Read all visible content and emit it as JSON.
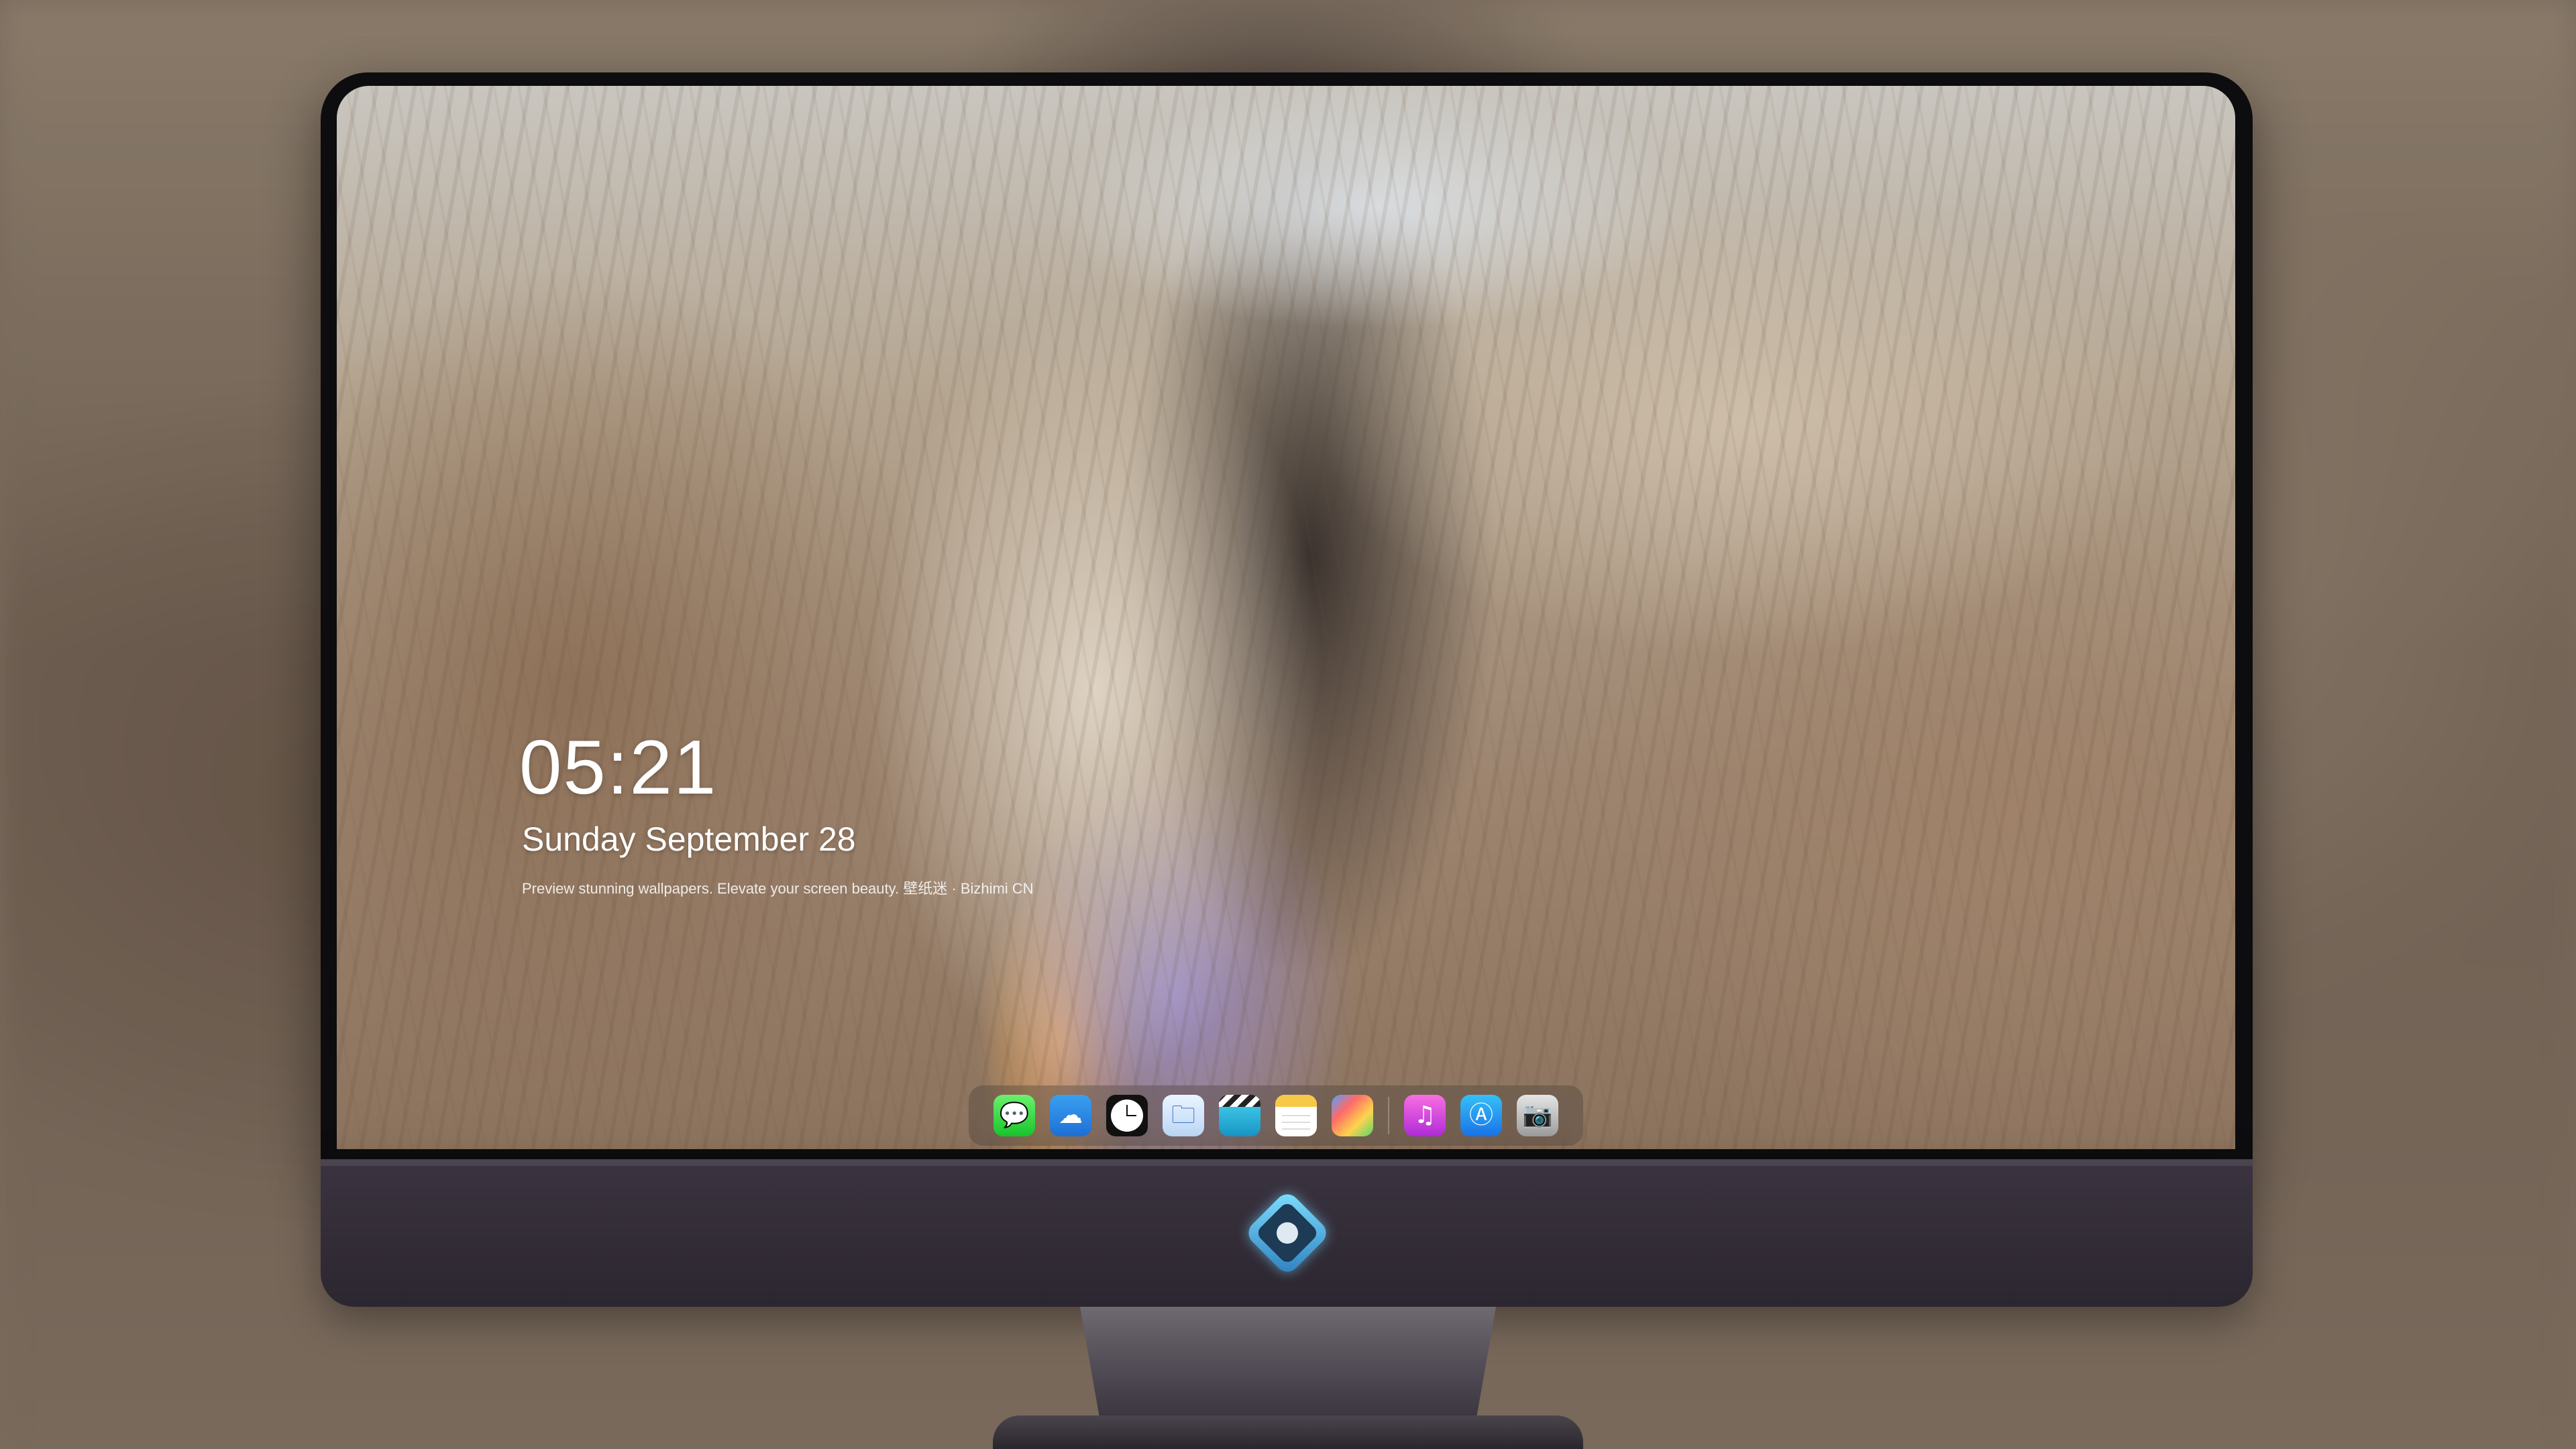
{
  "lock_screen": {
    "time": "05:21",
    "date": "Sunday September  28",
    "tagline": "Preview stunning wallpapers. Elevate your screen beauty. 壁纸迷 · Bizhimi CN"
  },
  "dock": {
    "apps": [
      {
        "name": "messages-icon",
        "glyph": "💬"
      },
      {
        "name": "weather-icon",
        "glyph": "☁"
      },
      {
        "name": "clock-icon",
        "glyph": ""
      },
      {
        "name": "preview-icon",
        "glyph": "🗀"
      },
      {
        "name": "clapperboard-icon",
        "glyph": ""
      },
      {
        "name": "notes-icon",
        "glyph": ""
      },
      {
        "name": "photos-icon",
        "glyph": ""
      },
      {
        "name": "music-icon",
        "glyph": "♫"
      },
      {
        "name": "app-store-icon",
        "glyph": "Ⓐ"
      },
      {
        "name": "camera-icon",
        "glyph": "📷"
      }
    ]
  },
  "monitor": {
    "logo": "mascot-logo-icon"
  },
  "colors": {
    "bezel": "#0d0d0f",
    "chin": "#3b3440",
    "clock_text": "#ffffff"
  }
}
